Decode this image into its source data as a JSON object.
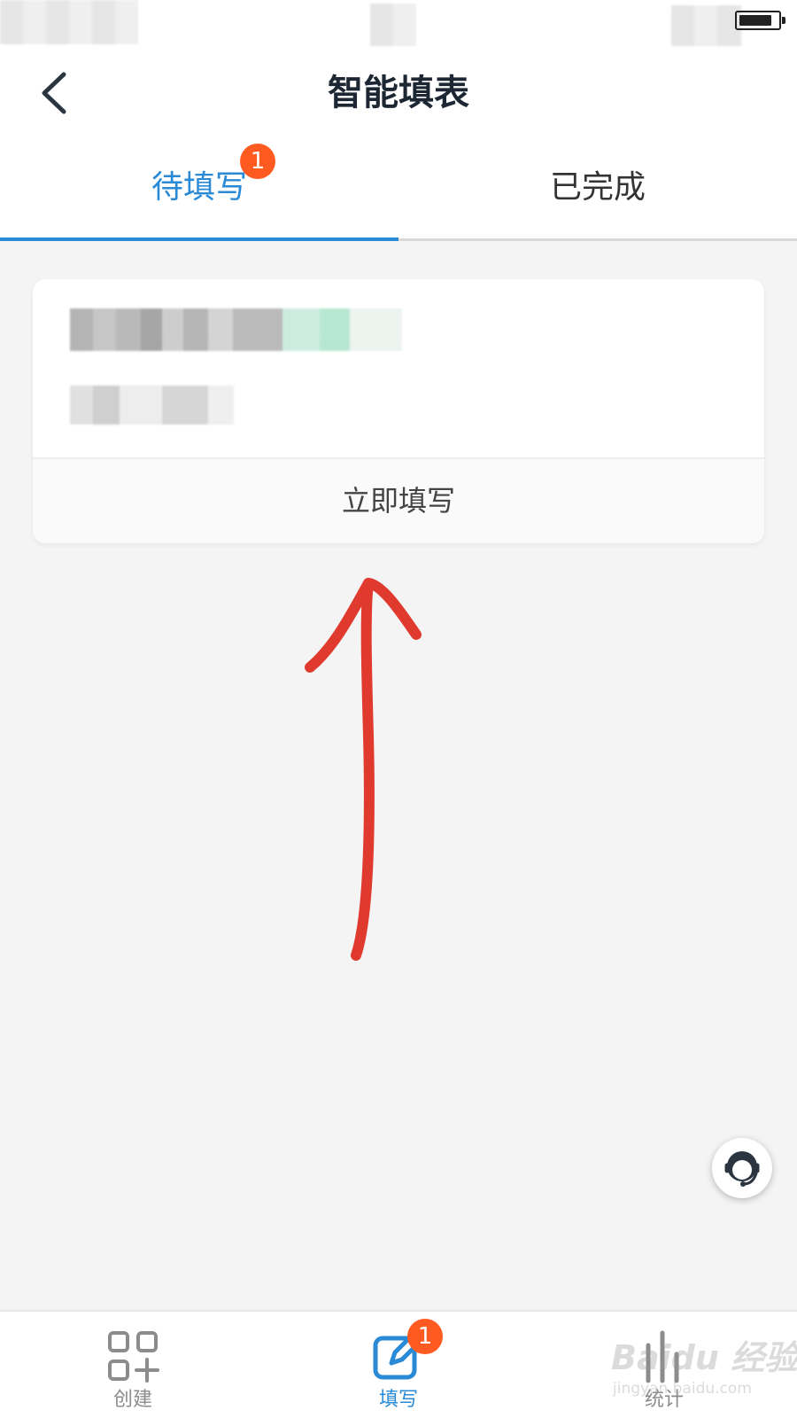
{
  "status_bar": {
    "battery_level": 0.85
  },
  "header": {
    "title": "智能填表",
    "back_icon": "chevron-left-icon"
  },
  "tabs": [
    {
      "label": "待填写",
      "badge": "1",
      "active": true
    },
    {
      "label": "已完成",
      "active": false
    }
  ],
  "form_card": {
    "action_label": "立即填写"
  },
  "annotation": {
    "arrow_color": "#e03a2f"
  },
  "support_button": {
    "icon": "customer-service-icon"
  },
  "bottom_nav": {
    "items": [
      {
        "label": "创建",
        "icon": "grid-plus-icon",
        "active": false
      },
      {
        "label": "填写",
        "icon": "edit-icon",
        "active": true,
        "badge": "1"
      },
      {
        "label": "统计",
        "icon": "bar-chart-icon",
        "active": false
      }
    ]
  },
  "watermark": {
    "brand": "Baidu 经验",
    "url": "jingyan.baidu.com"
  },
  "colors": {
    "accent": "#2a8ad6",
    "badge": "#ff5a1f",
    "background": "#f4f4f4"
  }
}
